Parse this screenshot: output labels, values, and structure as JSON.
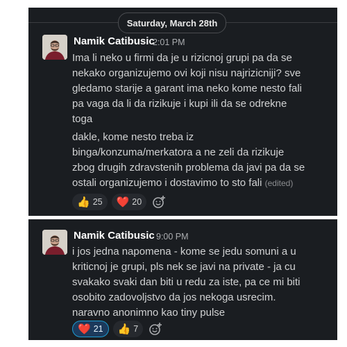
{
  "date_divider": "Saturday, March 28th",
  "messages": [
    {
      "author": "Namik Catibusic",
      "time": "2:01 PM",
      "text": "Ima li neko u firmi da je u rizicnoj grupi pa da se\nnekako organizujemo ovi koji nisu najrizicniji? sve\ngledamo starije a garant ima neko kome nesto fali\npa vaga da li da rizikuje i kupi ili da se odrekne\ntoga",
      "text2": "dakle, kome nesto treba iz\nbinga/konzuma/merkatora a ne zeli da rizikuje\nzbog drugih zdravstenih problema da javi pa da se\nostali organizujemo i dostavimo to sto fali",
      "edited": "(edited)",
      "reactions": [
        {
          "emoji": "👍",
          "icon": "thumbs-up",
          "count": "25",
          "active": false
        },
        {
          "emoji": "❤️",
          "icon": "heart",
          "count": "20",
          "active": false
        }
      ]
    },
    {
      "author": "Namik Catibusic",
      "time": "9:00 PM",
      "text": "i jos jedna napomena - kome se jedu somuni a u\nkriticnoj je grupi, pls nek se javi na private - ja cu\nsvakako svaki dan biti u redu za iste, pa ce mi biti\nosobito zadovoljstvo da jos nekoga usrecim.\nnaravno anonimno kao tiny pulse",
      "reactions": [
        {
          "emoji": "❤️",
          "icon": "heart",
          "count": "21",
          "active": true
        },
        {
          "emoji": "👍",
          "icon": "thumbs-up",
          "count": "7",
          "active": false
        }
      ]
    }
  ],
  "colors": {
    "background": "#1a1d21",
    "text": "#d1d2d3",
    "active_reaction_border": "#1d9bd1"
  }
}
